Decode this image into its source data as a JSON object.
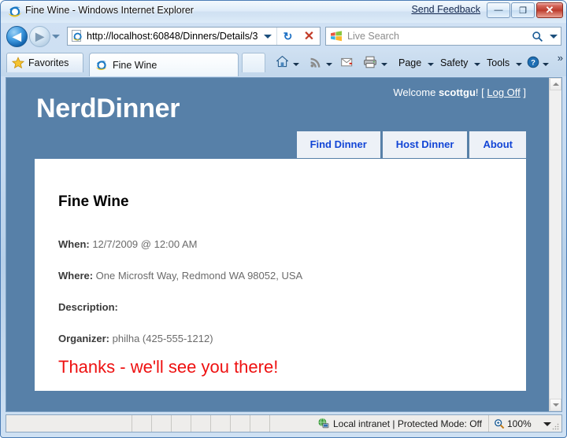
{
  "window": {
    "title": "Fine Wine - Windows Internet Explorer",
    "send_feedback": "Send Feedback",
    "minimize_glyph": "—",
    "maximize_glyph": "❐",
    "close_glyph": "✕"
  },
  "navigation": {
    "back_glyph": "◀",
    "forward_glyph": "▶",
    "address_value": "http://localhost:60848/Dinners/Details/3",
    "refresh_glyph": "↻",
    "stop_glyph": "✕",
    "search_placeholder": "Live Search"
  },
  "tabbar": {
    "favorites_label": "Favorites",
    "page_tab_label": "Fine Wine",
    "commands": [
      {
        "label": "",
        "name": "home-icon",
        "caret": true
      },
      {
        "label": "",
        "name": "feeds-icon",
        "caret": true
      },
      {
        "label": "",
        "name": "read-mail-icon",
        "caret": false
      },
      {
        "label": "",
        "name": "print-icon",
        "caret": true
      },
      {
        "label": "Page",
        "name": "page-menu",
        "caret": true
      },
      {
        "label": "Safety",
        "name": "safety-menu",
        "caret": true
      },
      {
        "label": "Tools",
        "name": "tools-menu",
        "caret": true
      },
      {
        "label": "",
        "name": "help-icon",
        "caret": true
      }
    ],
    "more_glyph": "»"
  },
  "site": {
    "logo": "NerdDinner",
    "welcome_prefix": "Welcome ",
    "welcome_user": "scottgu",
    "welcome_suffix": "! [ ",
    "logoff_label": "Log Off",
    "welcome_end": " ]",
    "nav_tabs": [
      {
        "label": "Find Dinner"
      },
      {
        "label": "Host Dinner"
      },
      {
        "label": "About"
      }
    ],
    "colors": {
      "header_blue": "#5780a8",
      "tab_bg": "#edf1f7",
      "tab_text": "#1245d6",
      "rsvp_red": "#ee1111"
    }
  },
  "dinner": {
    "title": "Fine Wine",
    "when_label": "When:",
    "when_value": " 12/7/2009 @ 12:00 AM",
    "where_label": "Where:",
    "where_value": " One Microsft Way, Redmond WA 98052, USA",
    "description_label": "Description:",
    "description_value": "",
    "organizer_label": "Organizer:",
    "organizer_value": " philha (425-555-1212)",
    "rsvp_message": "Thanks - we'll see you there!"
  },
  "statusbar": {
    "zone_text": "Local intranet | Protected Mode: Off",
    "zoom_level": "100%"
  }
}
